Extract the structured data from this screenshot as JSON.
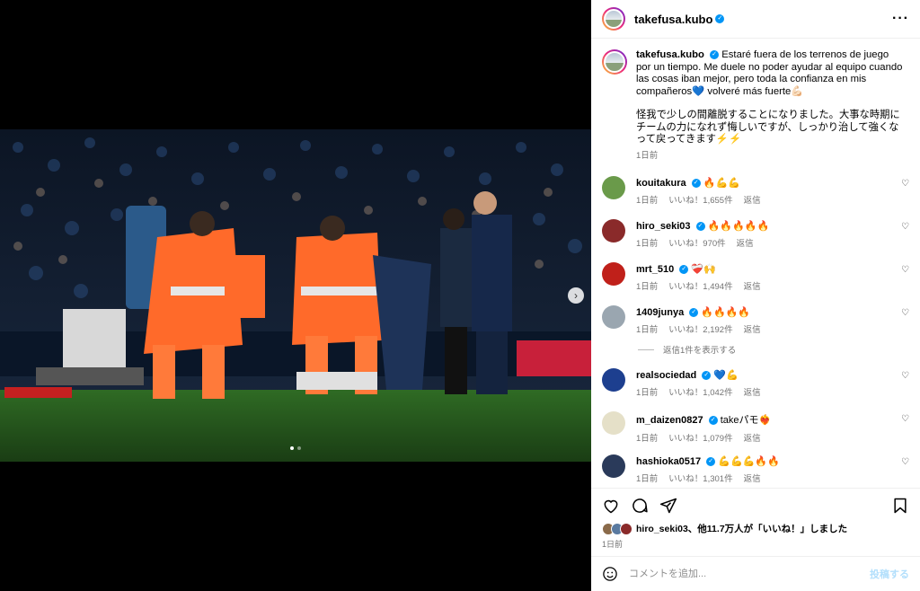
{
  "post": {
    "username": "takefusa.kubo",
    "caption_es": "Estaré fuera de los terrenos de juego por un tiempo. Me duele no poder ayudar al equipo cuando las cosas iban mejor, pero toda la confianza en mis compañeros💙 volveré más fuerte💪🏻",
    "caption_jp": "怪我で少しの間離脱することになりました。大事な時期にチームの力になれず悔しいですが、しっかり治して強くなって戻ってきます⚡️⚡️",
    "time": "1日前"
  },
  "icons": {
    "more": "more-options-icon",
    "next": "chevron-right-icon",
    "like": "heart-icon",
    "comment": "comment-icon",
    "share": "share-icon",
    "save": "bookmark-icon",
    "emoji": "emoji-icon"
  },
  "comments": [
    {
      "user": "kouitakura",
      "text": "🔥💪💪",
      "time": "1日前",
      "likes": "いいね！1,655件",
      "reply": "返信",
      "avatar_color": "#6a9a4a"
    },
    {
      "user": "hiro_seki03",
      "text": "🔥🔥🔥🔥🔥",
      "time": "1日前",
      "likes": "いいね！970件",
      "reply": "返信",
      "avatar_color": "#8a2a2a"
    },
    {
      "user": "mrt_510",
      "text": "❤️‍🩹🙌",
      "time": "1日前",
      "likes": "いいね！1,494件",
      "reply": "返信",
      "avatar_color": "#c0201a"
    },
    {
      "user": "1409junya",
      "text": "🔥🔥🔥🔥",
      "time": "1日前",
      "likes": "いいね！2,192件",
      "reply": "返信",
      "avatar_color": "#9aa6b0"
    },
    {
      "user": "realsociedad",
      "text": "💙💪",
      "time": "1日前",
      "likes": "いいね！1,042件",
      "reply": "返信",
      "avatar_color": "#1d3f8f"
    },
    {
      "user": "m_daizen0827",
      "text": "takeパモ❤️‍🔥",
      "time": "1日前",
      "likes": "いいね！1,079件",
      "reply": "返信",
      "avatar_color": "#e5e0c8"
    },
    {
      "user": "hashioka0517",
      "text": "💪💪💪🔥🔥",
      "time": "1日前",
      "likes": "いいね！1,301件",
      "reply": "返信",
      "avatar_color": "#2a3a5a"
    }
  ],
  "show_replies": "返信1件を表示する",
  "likes_summary": {
    "user": "hiro_seki03",
    "text": "、他11.7万人が「いいね！」しました",
    "time": "1日前"
  },
  "composer": {
    "placeholder": "コメントを追加...",
    "post_label": "投稿する"
  }
}
